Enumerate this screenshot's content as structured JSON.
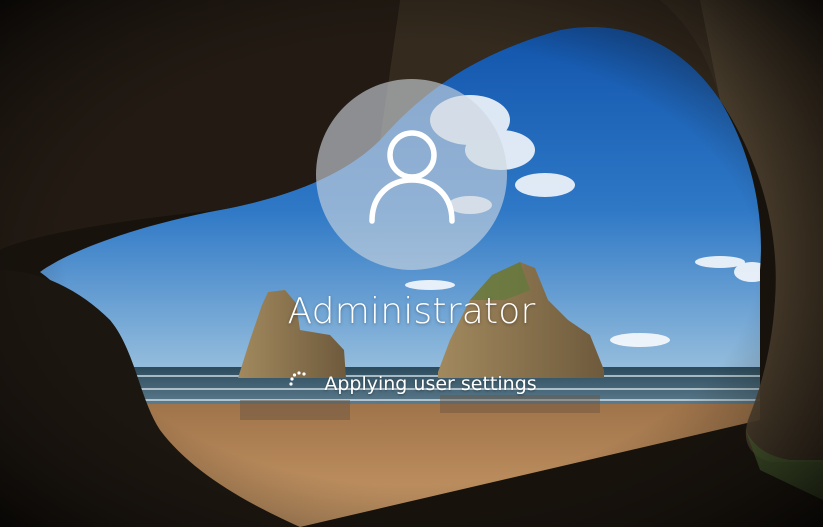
{
  "login": {
    "username": "Administrator",
    "status": "Applying user settings"
  },
  "icons": {
    "avatar": "user-silhouette-icon",
    "spinner": "loading-dots-icon"
  },
  "colors": {
    "text": "#ffffff",
    "avatar_bg": "#ced6de",
    "sky": "#2e6fb8",
    "sand": "#b8895a"
  }
}
